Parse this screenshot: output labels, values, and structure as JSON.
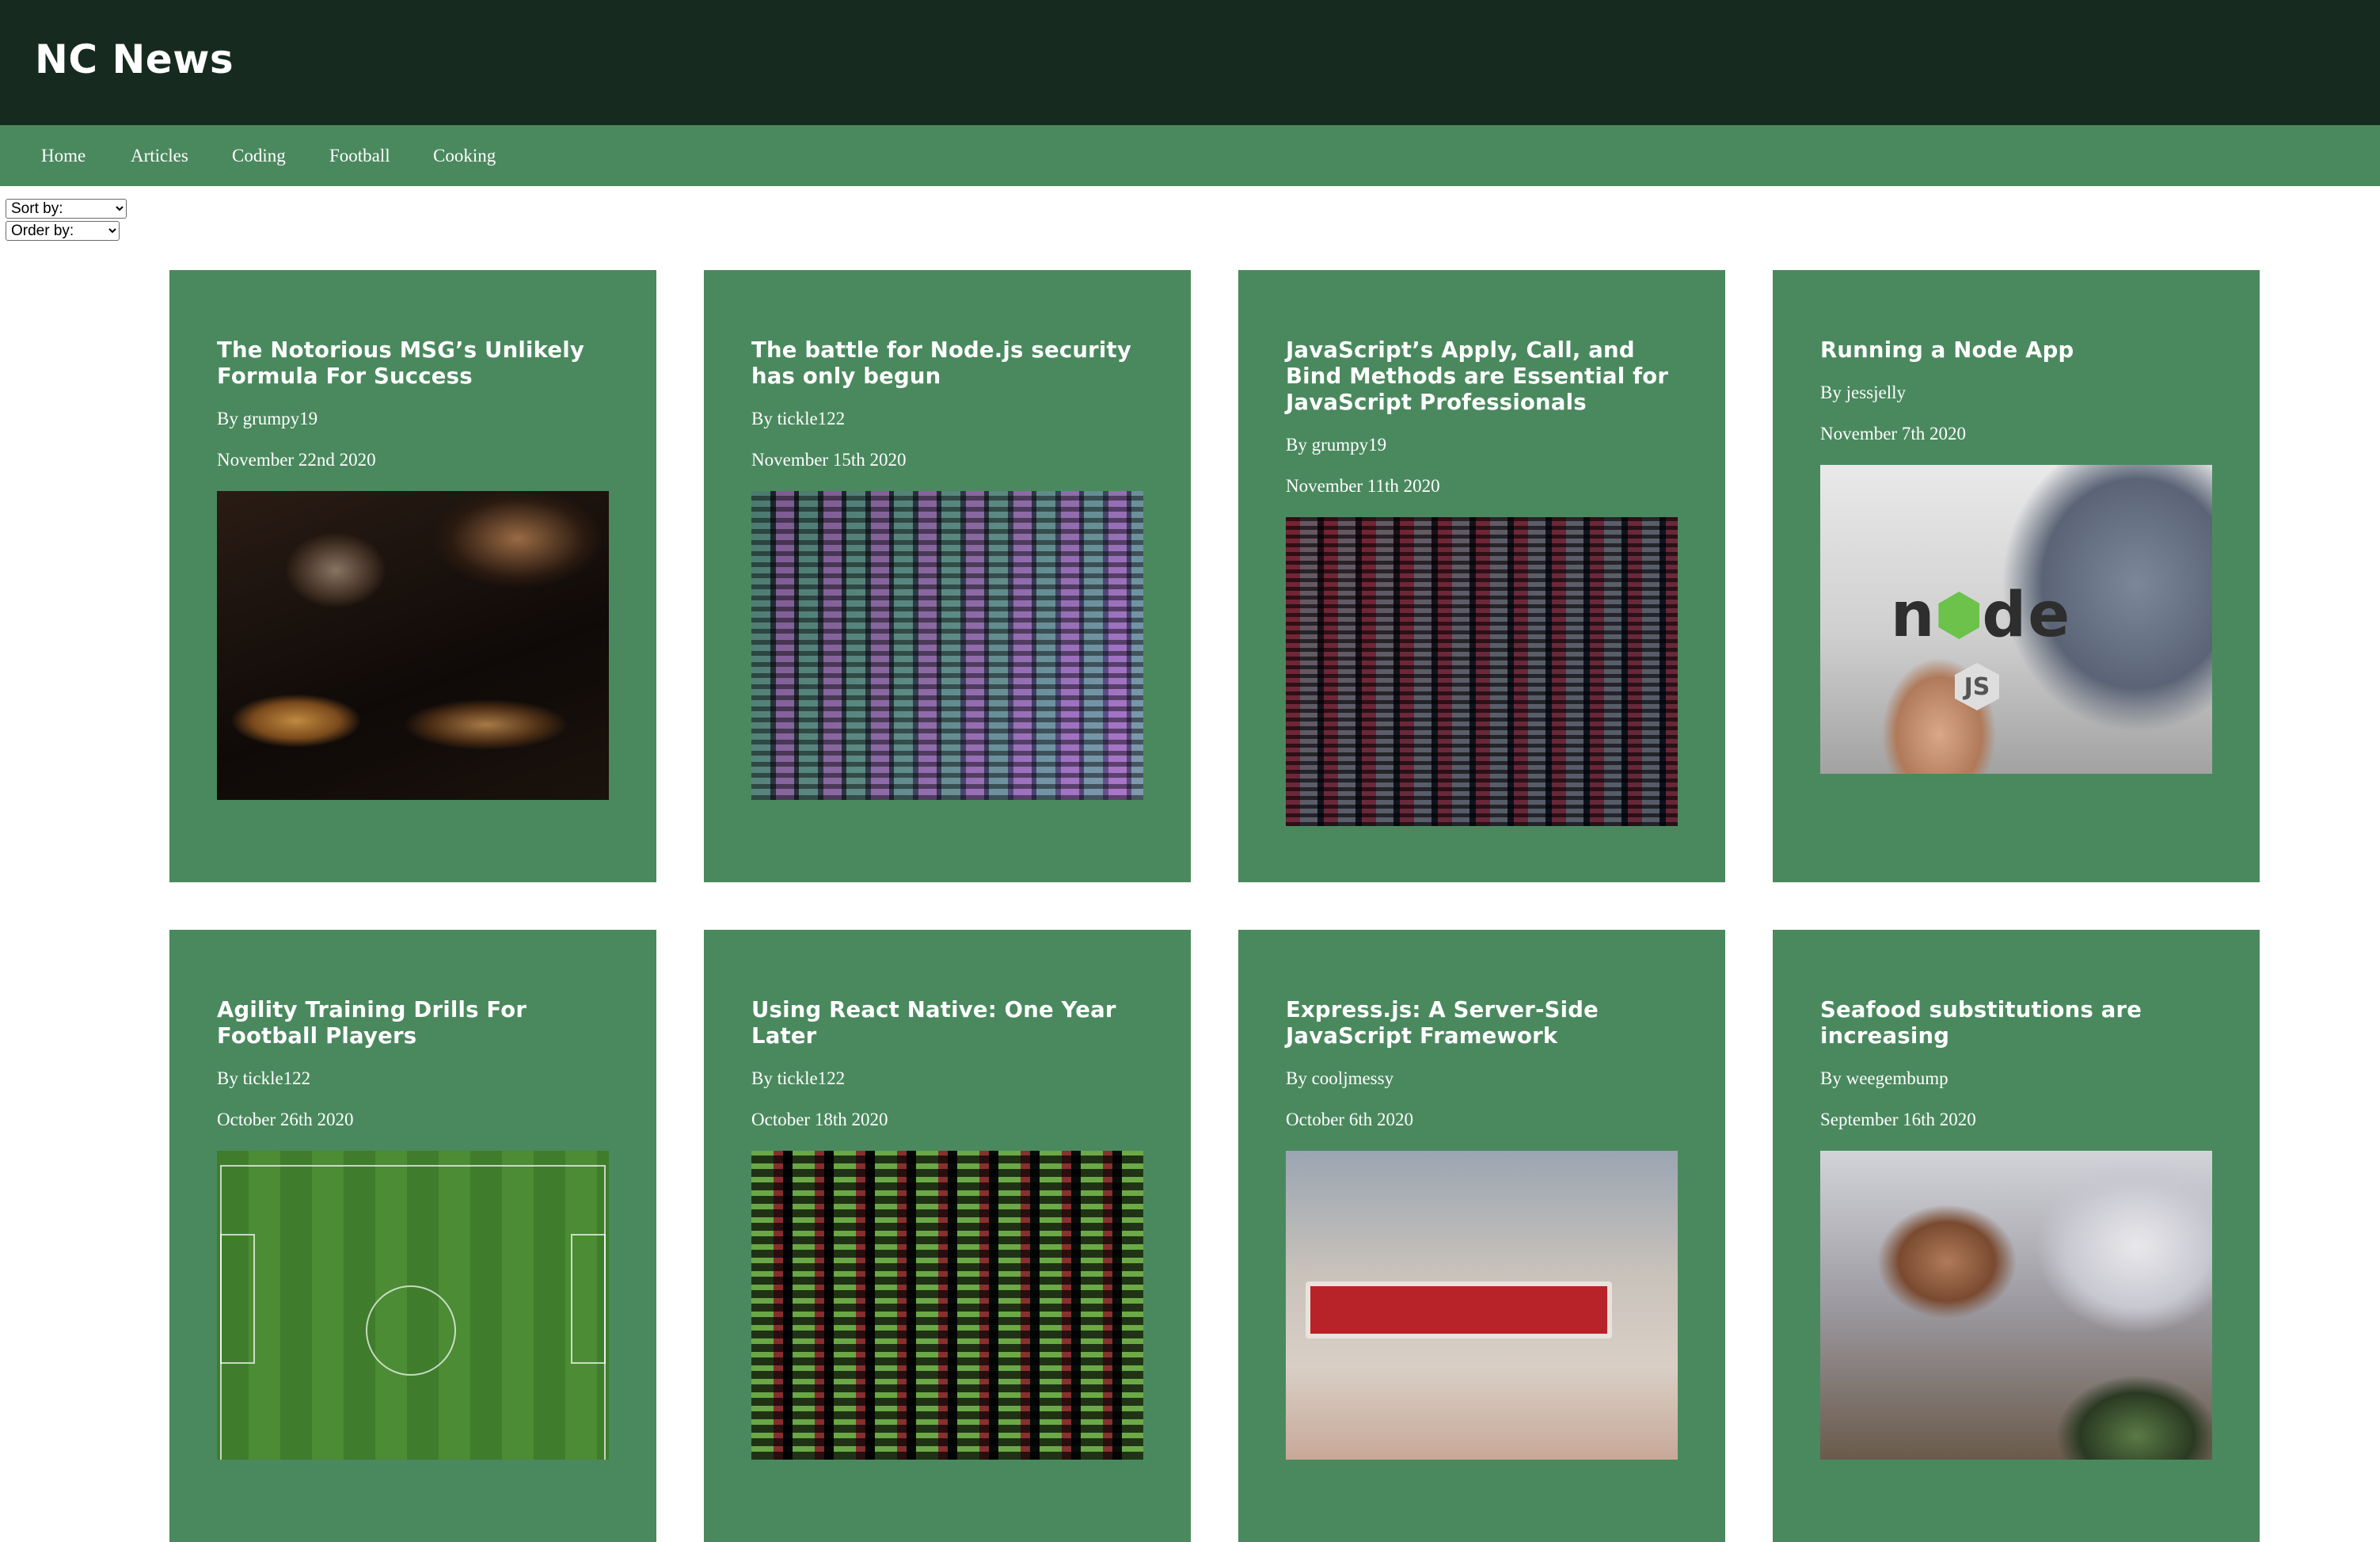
{
  "app": {
    "title": "NC News"
  },
  "nav": {
    "items": [
      {
        "label": "Home"
      },
      {
        "label": "Articles"
      },
      {
        "label": "Coding"
      },
      {
        "label": "Football"
      },
      {
        "label": "Cooking"
      }
    ]
  },
  "controls": {
    "sort_by": "Sort by:",
    "order_by": "Order by:"
  },
  "articles": [
    {
      "title": "The Notorious MSG’s Unlikely Formula For Success",
      "author": "By grumpy19",
      "date": "November 22nd 2020",
      "image_icon": "cooking-photo"
    },
    {
      "title": "The battle for Node.js security has only begun",
      "author": "By tickle122",
      "date": "November 15th 2020",
      "image_icon": "code-screen-photo"
    },
    {
      "title": "JavaScript’s Apply, Call, and Bind Methods are Essential for JavaScript Professionals",
      "author": "By grumpy19",
      "date": "November 11th 2020",
      "image_icon": "code-screen-photo"
    },
    {
      "title": "Running a Node App",
      "author": "By jessjelly",
      "date": "November 7th 2020",
      "image_icon": "nodejs-sticker-photo"
    },
    {
      "title": "Agility Training Drills For Football Players",
      "author": "By tickle122",
      "date": "October 26th 2020",
      "image_icon": "football-pitch-photo"
    },
    {
      "title": "Using React Native: One Year Later",
      "author": "By tickle122",
      "date": "October 18th 2020",
      "image_icon": "code-screen-photo"
    },
    {
      "title": "Express.js: A Server-Side JavaScript Framework",
      "author": "By cooljmessy",
      "date": "October 6th 2020",
      "image_icon": "sign-photo"
    },
    {
      "title": "Seafood substitutions are increasing",
      "author": "By weegembump",
      "date": "September 16th 2020",
      "image_icon": "seafood-cooking-photo"
    }
  ],
  "colors": {
    "header_bg": "#172a1f",
    "accent_green": "#4a895e",
    "text_on_green": "#ffffff"
  }
}
